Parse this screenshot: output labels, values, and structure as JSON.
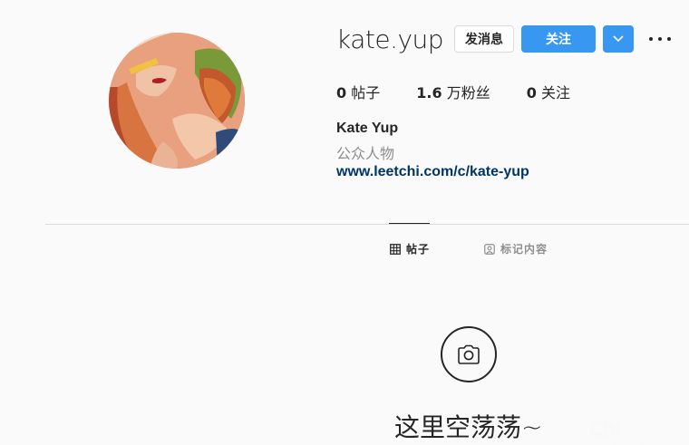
{
  "profile": {
    "username": "kate.yup",
    "full_name": "Kate Yup",
    "category": "公众人物",
    "link": "www.leetchi.com/c/kate-yup"
  },
  "actions": {
    "message_label": "发消息",
    "follow_label": "关注",
    "dropdown_icon": "chevron-down-icon",
    "more_icon": "more-options-icon"
  },
  "stats": {
    "posts_count": "0",
    "posts_label": "帖子",
    "followers_count": "1.6",
    "followers_label": "万粉丝",
    "following_count": "0",
    "following_label": "关注"
  },
  "tabs": [
    {
      "label": "帖子",
      "icon": "grid-icon",
      "active": true
    },
    {
      "label": "标记内容",
      "icon": "tagged-user-icon",
      "active": false
    }
  ],
  "empty_state": {
    "icon": "camera-icon",
    "text": "这里空荡荡~"
  },
  "watermark": "Chi na2uk",
  "colors": {
    "accent": "#3897f0",
    "link": "#003569",
    "text": "#262626",
    "muted": "#8e8e8e",
    "background": "#fafafa"
  }
}
